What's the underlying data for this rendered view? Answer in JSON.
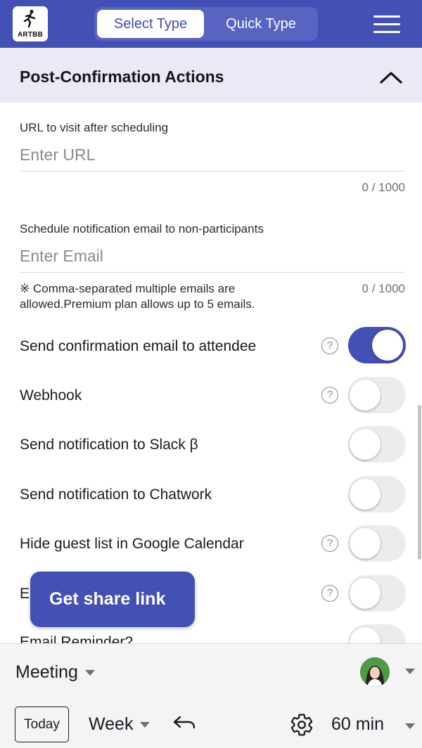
{
  "header": {
    "logo_text": "ARTBB",
    "tabs": [
      {
        "label": "Select Type",
        "active": true
      },
      {
        "label": "Quick Type",
        "active": false
      }
    ],
    "accent_color": "#4350b5"
  },
  "section": {
    "title": "Post-Confirmation Actions",
    "expanded": true
  },
  "url_field": {
    "label": "URL to visit after scheduling",
    "placeholder": "Enter URL",
    "value": "",
    "counter": "0 / 1000"
  },
  "email_field": {
    "label": "Schedule notification email to non-participants",
    "placeholder": "Enter Email",
    "value": "",
    "counter": "0 / 1000",
    "note": "※ Comma-separated multiple emails are allowed.Premium plan allows up to 5 emails."
  },
  "toggles": [
    {
      "label": "Send confirmation email to attendee",
      "help": true,
      "on": true
    },
    {
      "label": "Webhook",
      "help": true,
      "on": false
    },
    {
      "label": "Send notification to Slack β",
      "help": false,
      "on": false
    },
    {
      "label": "Send notification to Chatwork",
      "help": false,
      "on": false
    },
    {
      "label": "Hide guest list in Google Calendar",
      "help": true,
      "on": false
    },
    {
      "label": "En",
      "help": true,
      "on": false
    },
    {
      "label": "Email Reminder?",
      "help": false,
      "on": false
    }
  ],
  "share_button": {
    "label": "Get share link"
  },
  "bottom_bar": {
    "event_type": "Meeting",
    "today_label": "Today",
    "view": "Week",
    "duration": "60 min"
  }
}
